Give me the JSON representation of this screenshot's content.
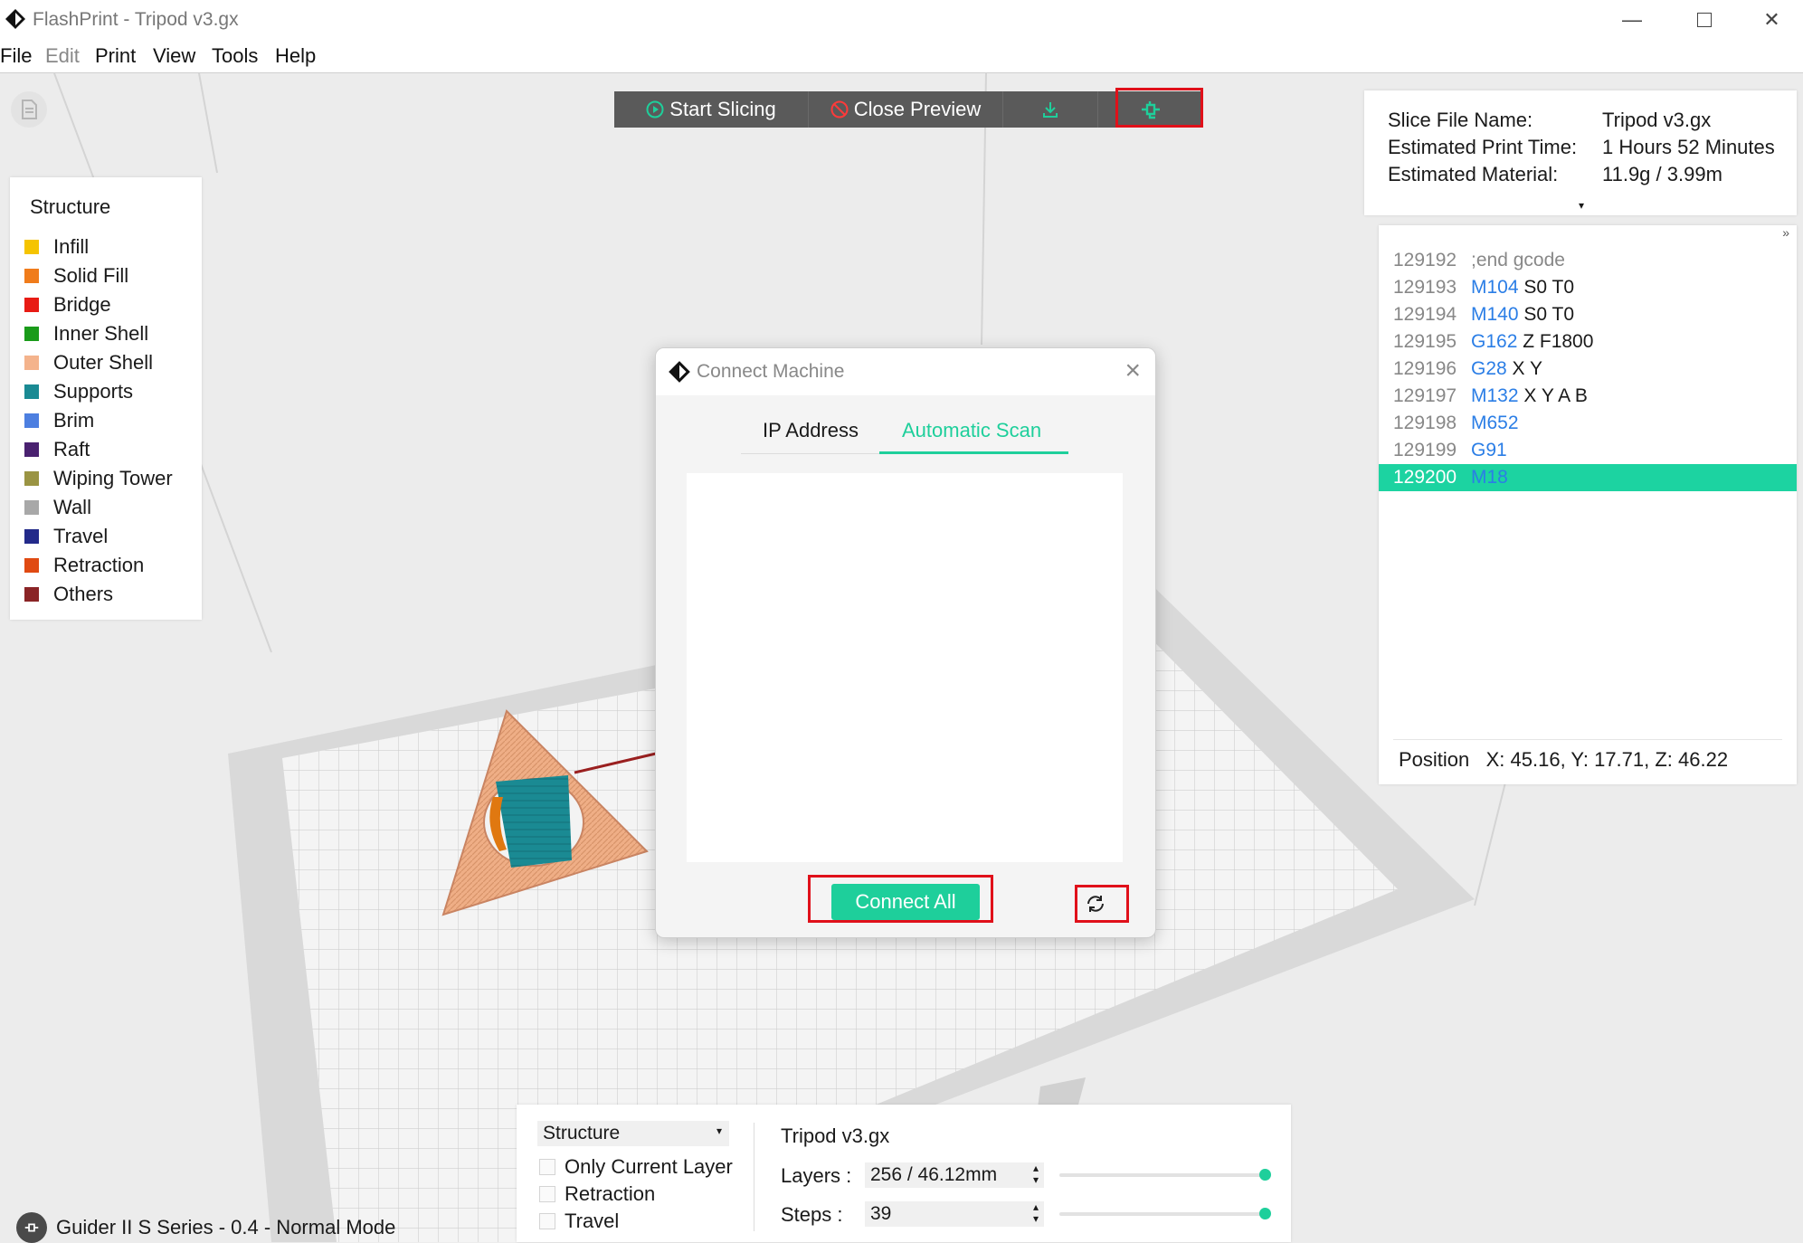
{
  "window": {
    "title": "FlashPrint - Tripod v3.gx"
  },
  "menu": [
    "File",
    "Edit",
    "Print",
    "View",
    "Tools",
    "Help"
  ],
  "toolbar": {
    "start_slicing": "Start Slicing",
    "close_preview": "Close Preview"
  },
  "legend": {
    "title": "Structure",
    "items": [
      {
        "label": "Infill",
        "color": "#f5c400"
      },
      {
        "label": "Solid Fill",
        "color": "#f07c1b"
      },
      {
        "label": "Bridge",
        "color": "#e81b14"
      },
      {
        "label": "Inner Shell",
        "color": "#1a9b1a"
      },
      {
        "label": "Outer Shell",
        "color": "#f4b38c"
      },
      {
        "label": "Supports",
        "color": "#1a8a93"
      },
      {
        "label": "Brim",
        "color": "#4d7fe0"
      },
      {
        "label": "Raft",
        "color": "#4a2170"
      },
      {
        "label": "Wiping Tower",
        "color": "#9a9443"
      },
      {
        "label": "Wall",
        "color": "#a8a8a8"
      },
      {
        "label": "Travel",
        "color": "#232a8a"
      },
      {
        "label": "Retraction",
        "color": "#e04a12"
      },
      {
        "label": "Others",
        "color": "#8a2426"
      }
    ]
  },
  "info": {
    "file_label": "Slice File Name:",
    "file_value": "Tripod v3.gx",
    "time_label": "Estimated Print Time:",
    "time_value": "1 Hours 52 Minutes",
    "material_label": "Estimated Material:",
    "material_value": "11.9g / 3.99m"
  },
  "gcode": {
    "lines": [
      {
        "num": "129192",
        "kw": "",
        "rest": ";end gcode",
        "comment": true
      },
      {
        "num": "129193",
        "kw": "M104",
        "rest": " S0 T0"
      },
      {
        "num": "129194",
        "kw": "M140",
        "rest": " S0 T0"
      },
      {
        "num": "129195",
        "kw": "G162",
        "rest": " Z F1800"
      },
      {
        "num": "129196",
        "kw": "G28",
        "rest": " X Y"
      },
      {
        "num": "129197",
        "kw": "M132",
        "rest": " X Y A B"
      },
      {
        "num": "129198",
        "kw": "M652",
        "rest": ""
      },
      {
        "num": "129199",
        "kw": "G91",
        "rest": ""
      },
      {
        "num": "129200",
        "kw": "M18",
        "rest": "",
        "selected": true
      }
    ],
    "position_label": "Position",
    "position_value": "X: 45.16, Y: 17.71, Z: 46.22"
  },
  "dialog": {
    "title": "Connect Machine",
    "tab_ip": "IP Address",
    "tab_scan": "Automatic Scan",
    "connect_all": "Connect All"
  },
  "bottom": {
    "structure_select": "Structure",
    "only_current_layer": "Only Current Layer",
    "retraction": "Retraction",
    "travel": "Travel",
    "filename": "Tripod v3.gx",
    "layers_label": "Layers :",
    "layers_value": "256 / 46.12mm",
    "steps_label": "Steps :",
    "steps_value": "39"
  },
  "status": {
    "machine": "Guider II S Series - 0.4 - Normal Mode"
  },
  "colors": {
    "accent": "#1ecf9b",
    "highlight": "#e0101a",
    "gcode_keyword": "#2b7ee6"
  }
}
